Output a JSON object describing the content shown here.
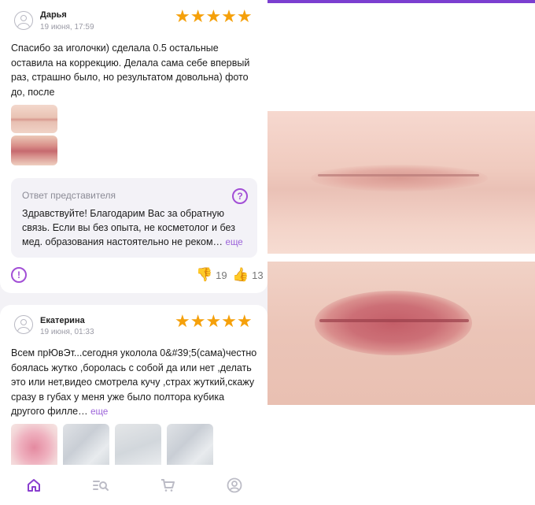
{
  "accent_color": "#a24fd6",
  "star_color": "#f5a00a",
  "reviews": [
    {
      "author": "Дарья",
      "date": "19 июня, 17:59",
      "rating": 5,
      "stars": "★★★★★",
      "text": "Спасибо за иголочки) сделала 0.5 остальные оставила на коррекцию. Делала сама себе впервый раз, страшно было, но результатом довольна) фото до, после",
      "reply": {
        "title": "Ответ представителя",
        "text": "Здравствуйте! Благодарим Вас за обратную связь. Если вы без опыта, не косметолог и без мед. образования настоятельно не реком…",
        "more": "еще",
        "icon": "question-bubble-icon"
      },
      "dislikes": "19",
      "likes": "13"
    },
    {
      "author": "Екатерина",
      "date": "19 июня, 01:33",
      "rating": 5,
      "stars": "★★★★★",
      "text": "Всем прЮвЭт...сегодня уколола 0&#39;5(сама)честно боялась жутко ,боролась с собой да или нет ,делать это или нет,видео смотрела кучу ,страх жуткий,скажу сразу в губах у меня уже было полтора кубика другого филле…",
      "more": "еще"
    }
  ],
  "tabbar": {
    "items": [
      "home-icon",
      "catalog-search-icon",
      "cart-icon",
      "profile-icon"
    ],
    "active": "home-icon"
  }
}
